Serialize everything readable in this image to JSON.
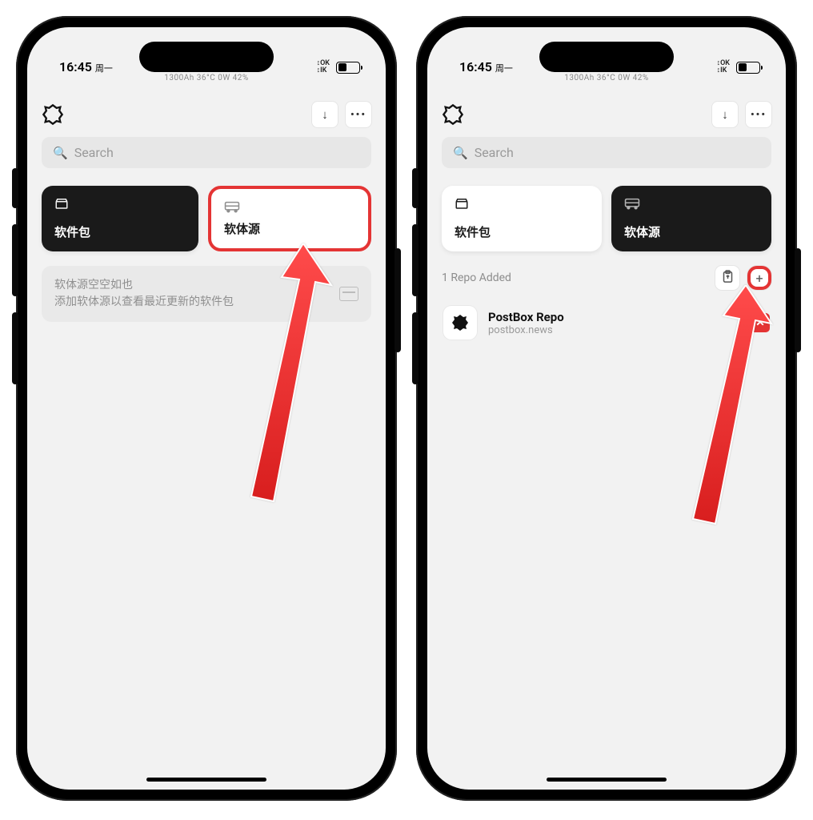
{
  "status": {
    "time": "16:45",
    "day": "周一",
    "mini": "1300Ah  36°C  0W  42%",
    "signal": "↕OK\n↕OK",
    "battery_text": "42"
  },
  "search": {
    "placeholder": "Search"
  },
  "cards": {
    "packages": "软件包",
    "sources": "软体源"
  },
  "left": {
    "empty_line1": "软体源空空如也",
    "empty_line2": "添加软体源以查看最近更新的软件包"
  },
  "right": {
    "section_title": "1 Repo Added",
    "repo": {
      "name": "PostBox Repo",
      "url": "postbox.news"
    }
  }
}
